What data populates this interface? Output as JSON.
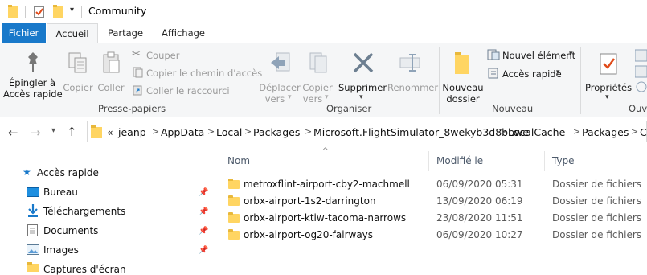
{
  "window": {
    "title": "Community"
  },
  "ribbon_tabs": [
    "Fichier",
    "Accueil",
    "Partage",
    "Affichage"
  ],
  "ribbon": {
    "clipboard": {
      "pin_label_1": "Épingler à",
      "pin_label_2": "Accès rapide",
      "copy": "Copier",
      "paste": "Coller",
      "cut": "Couper",
      "copy_path": "Copier le chemin d'accès",
      "paste_shortcut": "Coller le raccourci",
      "group": "Presse-papiers"
    },
    "organize": {
      "move_1": "Déplacer",
      "move_2": "vers",
      "copyto_1": "Copier",
      "copyto_2": "vers",
      "delete": "Supprimer",
      "rename": "Renommer",
      "group": "Organiser"
    },
    "new": {
      "new_folder_1": "Nouveau",
      "new_folder_2": "dossier",
      "new_item": "Nouvel élément",
      "easy_access": "Accès rapide",
      "group": "Nouveau"
    },
    "open": {
      "properties": "Propriétés",
      "group": "Ouvr"
    }
  },
  "address": {
    "overflow": "«",
    "crumbs": [
      "jeanp",
      "AppData",
      "Local",
      "Packages",
      "Microsoft.FlightSimulator_8wekyb3d8bbwe",
      "LocalCache",
      "Packages",
      "C"
    ]
  },
  "nav": {
    "quick_access": "Accès rapide",
    "items": [
      "Bureau",
      "Téléchargements",
      "Documents",
      "Images",
      "Captures d'écran"
    ]
  },
  "columns": {
    "name": "Nom",
    "modified": "Modifié le",
    "type": "Type"
  },
  "files": [
    {
      "name": "metroxflint-airport-cby2-machmell",
      "modified": "06/09/2020 05:31",
      "type": "Dossier de fichiers"
    },
    {
      "name": "orbx-airport-1s2-darrington",
      "modified": "13/09/2020 06:19",
      "type": "Dossier de fichiers"
    },
    {
      "name": "orbx-airport-ktiw-tacoma-narrows",
      "modified": "23/08/2020 11:51",
      "type": "Dossier de fichiers"
    },
    {
      "name": "orbx-airport-og20-fairways",
      "modified": "06/09/2020 10:27",
      "type": "Dossier de fichiers"
    }
  ],
  "colors": {
    "accent": "#1979ca",
    "folder": "#ffd562",
    "ribbon_bg": "#f5f6f7"
  }
}
